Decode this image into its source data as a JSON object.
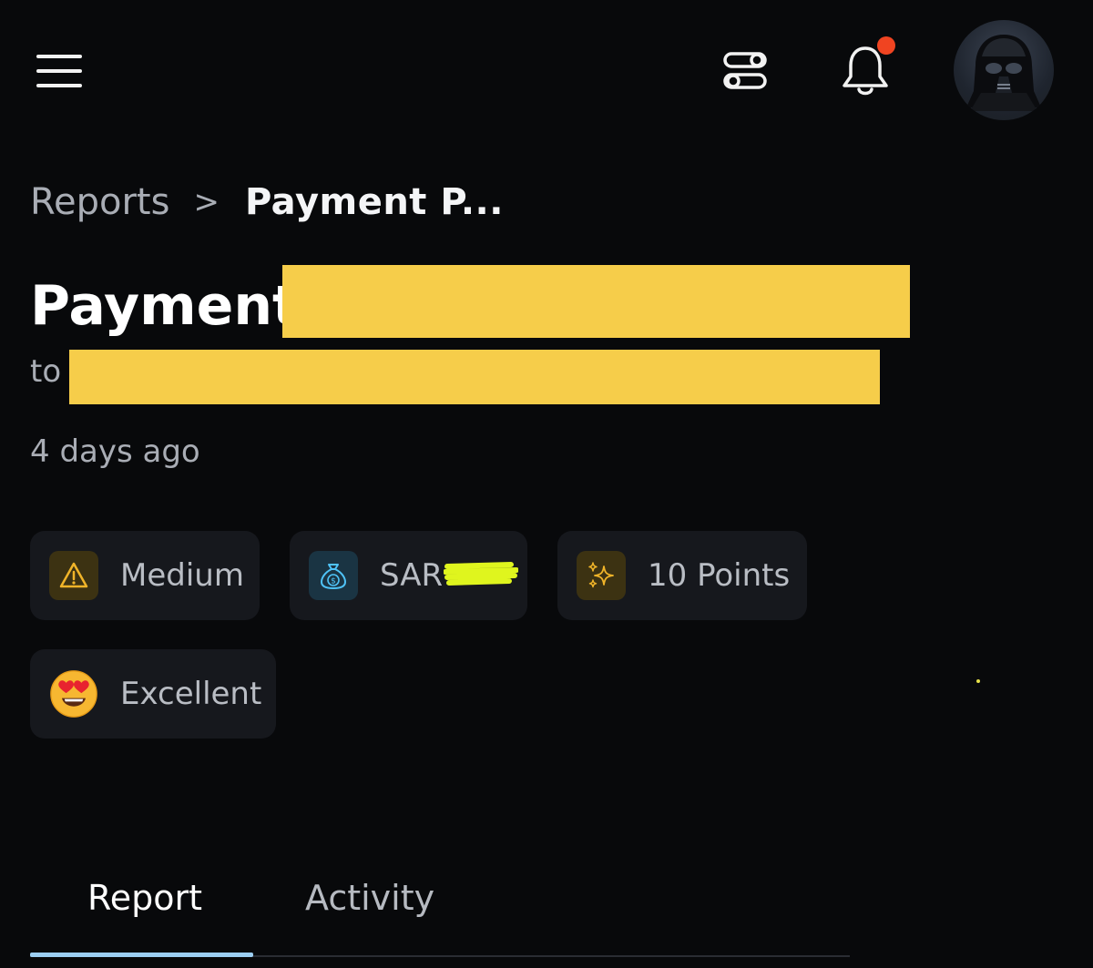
{
  "header": {
    "menu_icon": "hamburger-menu-icon",
    "filter_icon": "toggles-icon",
    "notification_icon": "bell-icon",
    "notification_badge_color": "#f04421",
    "avatar_icon": "darth-vader-avatar"
  },
  "breadcrumb": {
    "parent": "Reports",
    "separator": ">",
    "current": "Payment P..."
  },
  "report": {
    "title": "Payment",
    "recipient_prefix": "to",
    "time_ago": "4 days ago",
    "redaction_color": "#f6cd4a"
  },
  "chips": {
    "severity": {
      "label": "Medium",
      "icon": "warning-triangle-icon",
      "color": "#f0b429"
    },
    "bounty": {
      "label": "SAR",
      "icon": "money-bag-icon",
      "color": "#4fc3f7"
    },
    "points": {
      "label": "10 Points",
      "icon": "sparkles-icon",
      "color": "#f0b429"
    },
    "rating": {
      "label": "Excellent",
      "icon": "heart-eyes-emoji-icon"
    }
  },
  "tabs": [
    {
      "label": "Report",
      "active": true
    },
    {
      "label": "Activity",
      "active": false
    }
  ],
  "colors": {
    "background": "#08090b",
    "chip_background": "#16181d",
    "active_tab_indicator": "#9ccff3"
  }
}
